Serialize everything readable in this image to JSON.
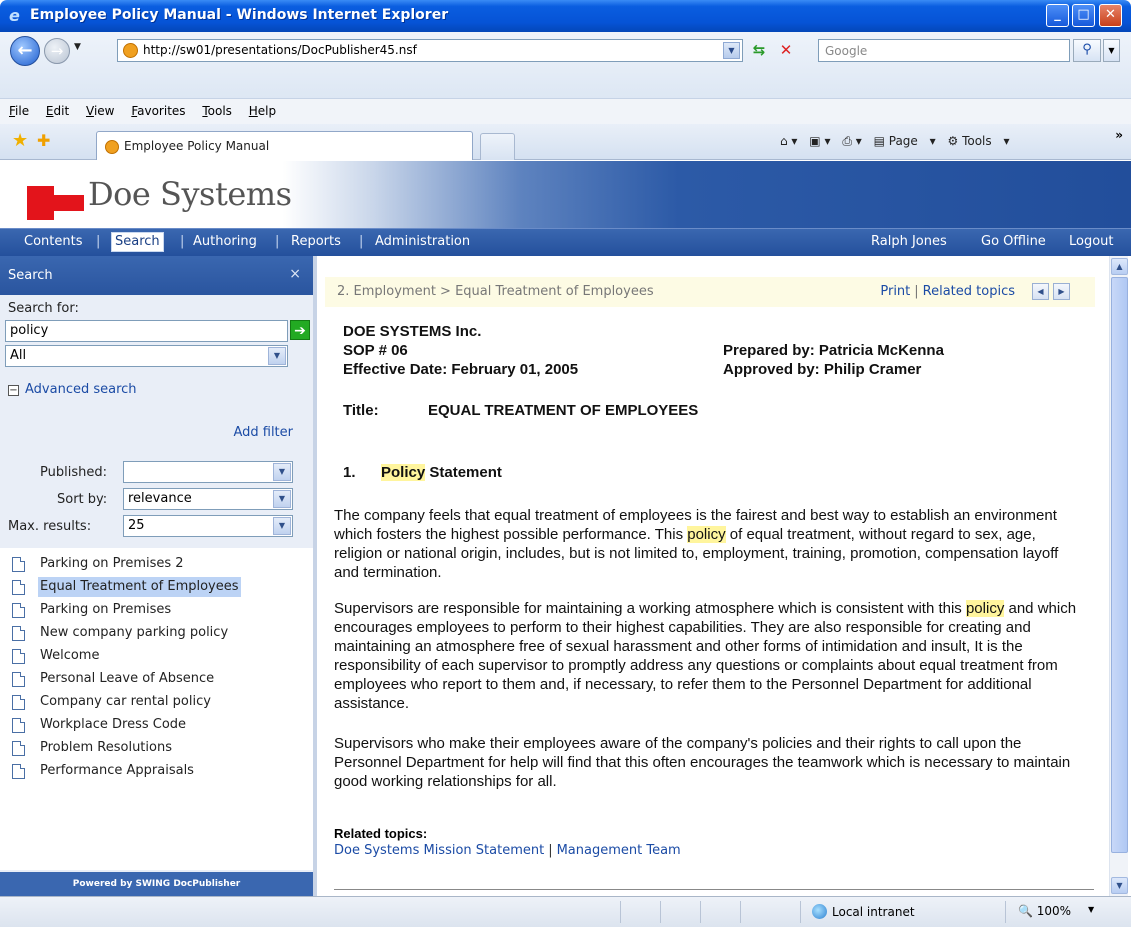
{
  "window": {
    "title": "Employee Policy Manual - Windows Internet Explorer"
  },
  "browser": {
    "url": "http://sw01/presentations/DocPublisher45.nsf",
    "search_placeholder": "Google",
    "menu": [
      "File",
      "Edit",
      "View",
      "Favorites",
      "Tools",
      "Help"
    ],
    "tab_title": "Employee Policy Manual",
    "cmd": {
      "page": "Page",
      "tools": "Tools"
    },
    "status": {
      "zone": "Local intranet",
      "zoom": "100%"
    }
  },
  "banner": {
    "logo_text": "Doe Systems",
    "brand_color": "#e3141b"
  },
  "nav": {
    "items": [
      "Contents",
      "Search",
      "Authoring",
      "Reports",
      "Administration"
    ],
    "active": "Search",
    "user": "Ralph Jones",
    "offline": "Go Offline",
    "logout": "Logout"
  },
  "search_panel": {
    "title": "Search",
    "search_for_label": "Search for:",
    "query": "policy",
    "scope": "All",
    "advanced_label": "Advanced search",
    "add_filter": "Add filter",
    "published_label": "Published:",
    "published_value": "",
    "sortby_label": "Sort by:",
    "sortby_value": "relevance",
    "maxresults_label": "Max. results:",
    "maxresults_value": "25",
    "results": [
      "Parking on Premises 2",
      "Equal Treatment of Employees",
      "Parking on Premises",
      "New company parking policy",
      "Welcome",
      "Personal Leave of Absence",
      "Company car rental policy",
      "Workplace Dress Code",
      "Problem Resolutions",
      "Performance Appraisals"
    ],
    "selected_result": "Equal Treatment of Employees",
    "footer": "Powered by SWING DocPublisher"
  },
  "document": {
    "breadcrumb": "2. Employment > Equal Treatment of Employees",
    "print": "Print",
    "related_link": "Related topics",
    "company": "DOE SYSTEMS Inc.",
    "sop": "SOP # 06",
    "effective": "Effective Date: February 01, 2005",
    "prepared": "Prepared by: Patricia McKenna",
    "approved": "Approved by: Philip Cramer",
    "title_label": "Title:",
    "title_value": "EQUAL TREATMENT OF EMPLOYEES",
    "section_num": "1.",
    "section_word": "Policy",
    "section_rest": " Statement",
    "p1_a": "The company feels that equal treatment of employees is the fairest and best way to establish an environment which fosters the highest possible performance. This ",
    "p1_hl": "policy",
    "p1_b": " of equal treatment, without regard to sex, age, religion or national origin, includes, but is not limited to, employment, training, promotion, compensation layoff and termination.",
    "p2_a": "Supervisors are responsible for maintaining a working atmosphere which is consistent with this ",
    "p2_hl": "policy",
    "p2_b": " and which encourages employees to perform to their highest capabilities. They are also responsible for creating and maintaining an atmosphere free of sexual harassment and other forms of intimidation and insult, It is the responsibility of each supervisor to promptly address any questions or complaints about equal treatment from employees who report to them and, if necessary, to refer them to the Personnel Department for additional assistance.",
    "p3": "Supervisors who make their employees aware of the company's policies and their rights to call upon the Personnel Department for help will find that this often encourages the teamwork which is necessary to maintain good working relationships for all.",
    "related_heading": "Related topics:",
    "related": [
      "Doe Systems Mission Statement",
      "Management Team"
    ]
  }
}
